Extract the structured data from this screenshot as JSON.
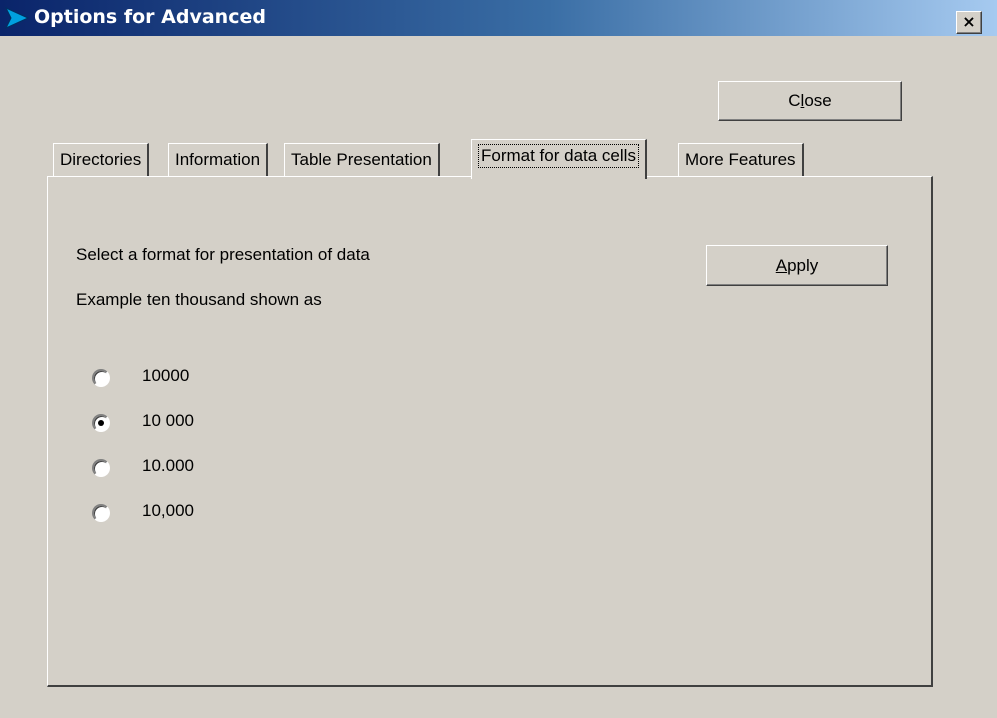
{
  "window": {
    "title": "Options for Advanced",
    "close_glyph": "×",
    "title_gradient": [
      "#0a246a",
      "#a6caf0"
    ]
  },
  "close_button": {
    "label_pre": "C",
    "label_accel": "l",
    "label_post": "ose"
  },
  "tabs": [
    {
      "label": "Directories",
      "active": false
    },
    {
      "label": "Information",
      "active": false
    },
    {
      "label": "Table Presentation",
      "active": false
    },
    {
      "label": "Format for data cells",
      "active": true
    },
    {
      "label": "More Features",
      "active": false
    }
  ],
  "panel": {
    "instruction": "Select a format for presentation of data",
    "example_label": "Example ten thousand shown as",
    "apply_button": {
      "label_accel": "A",
      "label_post": "pply"
    },
    "formats": [
      {
        "label": "10000",
        "selected": false
      },
      {
        "label": "10 000",
        "selected": true
      },
      {
        "label": "10.000",
        "selected": false
      },
      {
        "label": "10,000",
        "selected": false
      }
    ]
  }
}
